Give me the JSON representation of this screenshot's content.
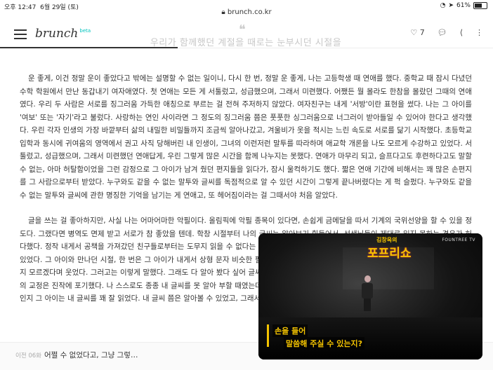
{
  "status": {
    "time": "오후 12:47",
    "date": "6월 29일 (토)",
    "url": "brunch.co.kr",
    "battery": "61%",
    "battery_level": 0.61
  },
  "header": {
    "logo": "brunch",
    "logo_badge": "beta",
    "title": "우리가 함께했던 계절을 때로는 눈부시던 시절을",
    "likes": "7",
    "reading_progress": 0.36
  },
  "article": {
    "paragraphs": [
      "운 좋게, 이건 정말 운이 좋았다고 밖에는 설명할 수 없는 일이니, 다시 한 번, 정말 운 좋게, 나는 고등학생 때 연애를 했다. 중학교 때 잠시 다녔던 수학 학원에서 만난 동갑내기 여자애였다. 첫 연애는 모든 게 서툴렀고, 성급했으며, 그래서 미련했다. 어쨌든 뭘 몰라도 한참을 몰랐던 그때의 연애였다. 우리 두 사람은 서로를 징그러움 가득한 애칭으로 부르는 걸 전혀 주저하지 않았다. 여자친구는 내게 '서방'이란 표현을 썼다. 나는 그 아이를 '여보' 또는 '자기'라고 불렀다. 사랑하는 연인 사이라면 그 정도의 징그러움 쯤은 풋풋한 싱그러움으로 너그러이 받아들일 수 있어야 한다고 생각했다. 우린 각자 인생의 가장 바깥부터 삶의 내밀한 비밀들까지 조금씩 알아나갔고, 겨울비가 옷을 적시는 느린 속도로 서로를 닮기 시작했다. 초등학교 입학과 동시에 귀여움의 영역에서 권고 사직 당해버린 내 인생이, 그녀의 이런저런 말투를 따라하며 애교학 개론을 나도 모르게 수강하고 있었다. 서툴렀고, 성급했으며, 그래서 미련했던 연애답게, 우린 그렇게 많은 시간을 함께 나누지는 못했다. 연애가 마무리 되고, 슬프다고도 후련하다고도 말할 수 없는, 아마 허탈함이었을 그런 감정으로 그 아이가 남겨 줬던 편지들을 읽다가, 잠시 울컥하기도 했다. 짧은 연애 기간에 비해서는 꽤 많은 손편지를 그 사람으로부터 받았다. 누구와도 같을 수 없는 말투와 글씨를 독점적으로 알 수 있던 시간이 그렇게 끝나버렸다는 게 퍽 슬펐다. 누구와도 같을 수 없는 말투와 글씨에 관한 명징한 기억을 남기는 게 연애고, 또 헤어짐이라는 걸 그때서야 처음 알았다.",
      "글을 쓰는 걸 좋아하지만, 사실 나는 어마어마한 악필이다. 올림픽에 악필 종목이 있다면, 손쉽게 금메달을 따서 기계의 국위선양을 할 수 있을 정도다. 그랬다면 병역도 면제 받고 서로가 참 좋았을 텐데. 학창 시절부터 나의 글씨는 알아보기 힘들어서, 선생님들이 제대로 읽지 못하는 경우가 허다했다. 정작 내게서 공책을 가져갔던 친구들로부터는 도무지 읽을 수 없다는 반응이 돌아왔다. 어떤 친구는 씨발, 이게 한국어냐, 라고 분노한 적도 있었다. 그 아이와 만나던 시절, 한 번은 그 아이가 내게서 상형 문자 비슷한 필기를 '그려' 넣었다니, 가독성이 현저히 떨어지긴 했지만 그래도 도무지 모르겠다며 웃었다. 그러고는 이렇게 말했다. 그래도 다 알아 봤다 싶어 글씨를 곧이 교정할 필요성은 못 느꼈다. 물론 정말 솔직히 말하자면 필체의 교정은 진작에 포기했다. 나 스스로도 종종 내 글씨를 못 알아 부할 때였는데, 무엇이 아람이고 무엇이 한글인지 분간이 안 되었다. 하지만 어째서인지 그 아이는 내 글씨를 꽤 잘 읽었다. 내 글씨 쯤은 알아볼 수 있었고, 그래서 나는 지금까지도 기가 막힌 악필로 남아 있다."
    ]
  },
  "footer": {
    "prev_label": "이전 06화",
    "prev_title": "어쩔 수 없었다고, 그냥 그렇…"
  },
  "pip": {
    "channel": "FOUNTREE TV",
    "show_sub": "김창옥의",
    "show_main": "포프리쇼",
    "caption_line1": "손을 들어",
    "caption_line2": "말씀해 주실 수 있는지?"
  }
}
